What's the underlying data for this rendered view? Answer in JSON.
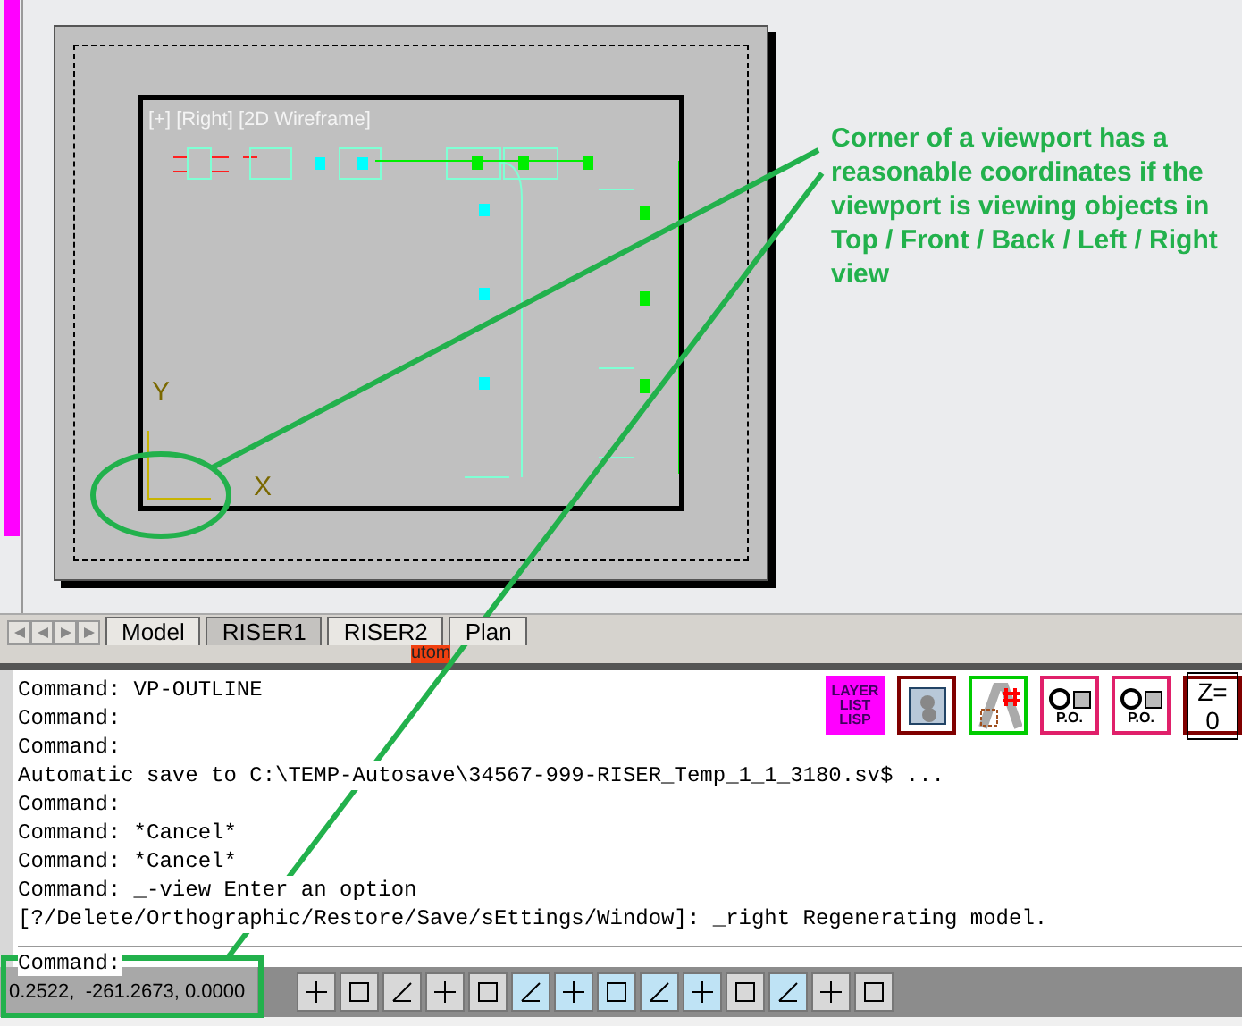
{
  "layout_tabs": [
    {
      "label": "Model",
      "selected": false
    },
    {
      "label": "RISER1",
      "selected": true
    },
    {
      "label": "RISER2",
      "selected": false
    },
    {
      "label": "Plan",
      "selected": false
    }
  ],
  "viewport": {
    "label": "[+] [Right] [2D Wireframe]",
    "ucs_axes": [
      "Y",
      "X"
    ]
  },
  "autoscroll_badge": "utom",
  "command_lines": [
    "Command: VP-OUTLINE",
    "Command:",
    "Command:",
    "Automatic save to C:\\TEMP-Autosave\\34567-999-RISER_Temp_1_1_3180.sv$ ...",
    "Command:",
    "Command: *Cancel*",
    "Command: *Cancel*",
    "Command: _-view Enter an option",
    "[?/Delete/Orthographic/Restore/Save/sEttings/Window]: _right Regenerating model."
  ],
  "command_prompt": "Command:",
  "toolbar": [
    {
      "kind": "text",
      "label": "LAYER LIST LISP",
      "color": "#ff00ff"
    },
    {
      "kind": "icon",
      "color": "#800000"
    },
    {
      "kind": "hash",
      "color": "#00cc00"
    },
    {
      "kind": "po",
      "label": "P.O.",
      "color": "#e0206a"
    },
    {
      "kind": "po",
      "label": "P.O.",
      "color": "#e0206a"
    },
    {
      "kind": "text",
      "label": "Z= 0",
      "color": "#800000"
    }
  ],
  "coordinates": "0.2522,  -261.2673, 0.0000",
  "status_toggles": [
    {
      "on": false
    },
    {
      "on": false
    },
    {
      "on": false
    },
    {
      "on": false
    },
    {
      "on": false
    },
    {
      "on": true
    },
    {
      "on": true
    },
    {
      "on": true
    },
    {
      "on": true
    },
    {
      "on": true
    },
    {
      "on": false
    },
    {
      "on": true
    },
    {
      "on": false
    },
    {
      "on": false
    }
  ],
  "annotation": "Corner of a viewport has a reasonable coordinates if the viewport is viewing objects in Top / Front / Back / Left / Right view"
}
